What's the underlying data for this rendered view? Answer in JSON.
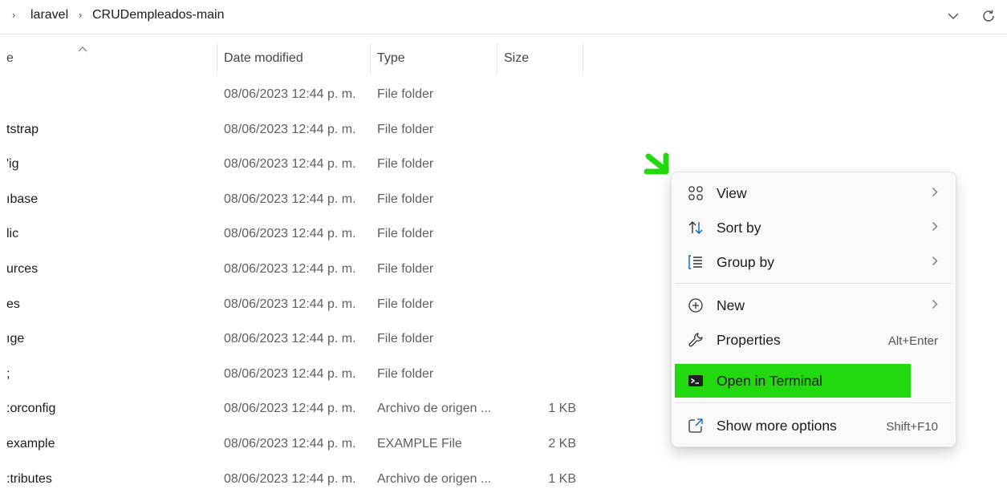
{
  "breadcrumb": {
    "items": [
      "laravel",
      "CRUDempleados-main"
    ]
  },
  "columns": {
    "name": "e",
    "date_modified": "Date modified",
    "type": "Type",
    "size": "Size"
  },
  "files": [
    {
      "name": "",
      "date": "08/06/2023 12:44 p. m.",
      "type": "File folder",
      "size": ""
    },
    {
      "name": "tstrap",
      "date": "08/06/2023 12:44 p. m.",
      "type": "File folder",
      "size": ""
    },
    {
      "name": "'ig",
      "date": "08/06/2023 12:44 p. m.",
      "type": "File folder",
      "size": ""
    },
    {
      "name": "ıbase",
      "date": "08/06/2023 12:44 p. m.",
      "type": "File folder",
      "size": ""
    },
    {
      "name": "lic",
      "date": "08/06/2023 12:44 p. m.",
      "type": "File folder",
      "size": ""
    },
    {
      "name": "urces",
      "date": "08/06/2023 12:44 p. m.",
      "type": "File folder",
      "size": ""
    },
    {
      "name": "es",
      "date": "08/06/2023 12:44 p. m.",
      "type": "File folder",
      "size": ""
    },
    {
      "name": "ıge",
      "date": "08/06/2023 12:44 p. m.",
      "type": "File folder",
      "size": ""
    },
    {
      "name": ";",
      "date": "08/06/2023 12:44 p. m.",
      "type": "File folder",
      "size": ""
    },
    {
      "name": ":orconfig",
      "date": "08/06/2023 12:44 p. m.",
      "type": "Archivo de origen ...",
      "size": "1 KB"
    },
    {
      "name": "example",
      "date": "08/06/2023 12:44 p. m.",
      "type": "EXAMPLE File",
      "size": "2 KB"
    },
    {
      "name": ":tributes",
      "date": "08/06/2023 12:44 p. m.",
      "type": "Archivo de origen ...",
      "size": "1 KB"
    }
  ],
  "context_menu": {
    "view": "View",
    "sort_by": "Sort by",
    "group_by": "Group by",
    "new": "New",
    "properties": "Properties",
    "properties_shortcut": "Alt+Enter",
    "open_terminal": "Open in Terminal",
    "more_options": "Show more options",
    "more_options_shortcut": "Shift+F10"
  },
  "colors": {
    "highlight": "#22d80f",
    "annotation": "#22d80f",
    "accent": "#0067c0"
  },
  "icons": [
    "chevron-right-icon",
    "chevron-down-icon",
    "refresh-icon",
    "sort-caret-up-icon",
    "grid-view-icon",
    "sort-icon",
    "group-icon",
    "plus-circle-icon",
    "wrench-icon",
    "terminal-icon",
    "external-options-icon",
    "green-arrow-icon"
  ]
}
